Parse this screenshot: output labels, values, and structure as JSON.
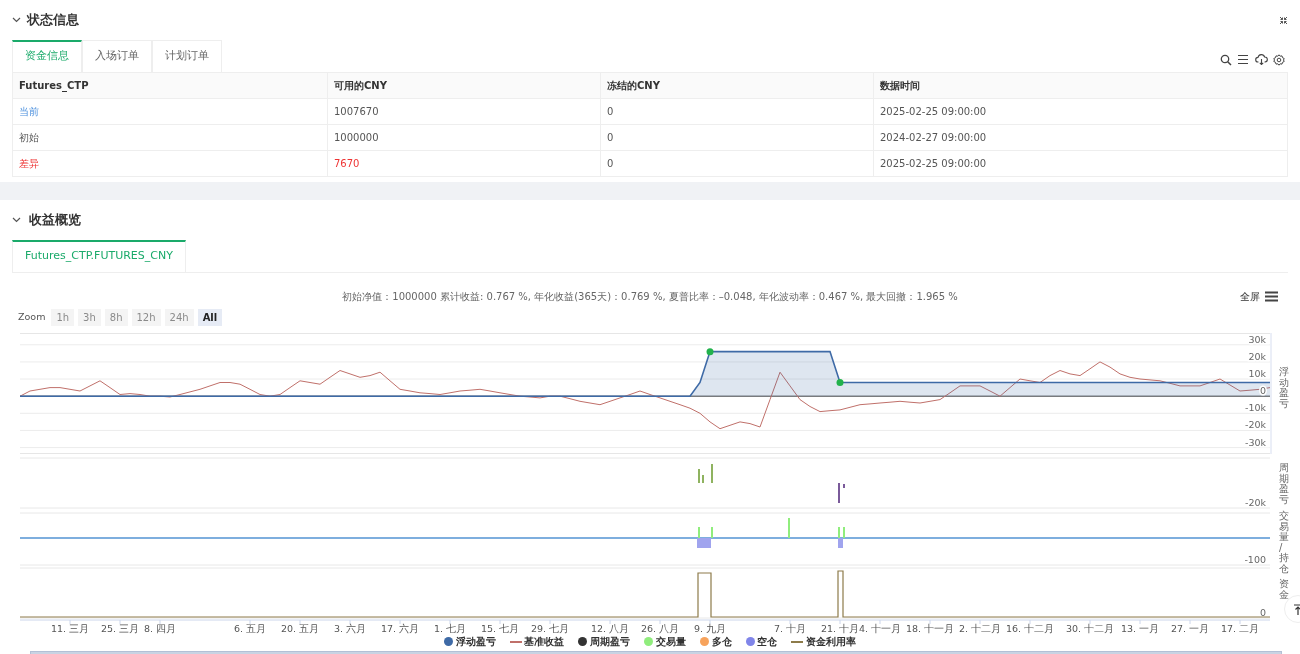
{
  "status_panel": {
    "title": "状态信息",
    "tabs": [
      {
        "label": "资金信息",
        "selected": true
      },
      {
        "label": "入场订单",
        "selected": false
      },
      {
        "label": "计划订单",
        "selected": false
      }
    ],
    "table": {
      "columns": [
        "Futures_CTP",
        "可用的CNY",
        "冻结的CNY",
        "数据时间"
      ],
      "rows": [
        {
          "kind": "current",
          "cells": [
            "当前",
            "1007670",
            "0",
            "2025-02-25 09:00:00"
          ]
        },
        {
          "kind": "initial",
          "cells": [
            "初始",
            "1000000",
            "0",
            "2024-02-27 09:00:00"
          ]
        },
        {
          "kind": "diff",
          "cells": [
            "差异",
            "7670",
            "0",
            "2025-02-25 09:00:00"
          ]
        }
      ]
    }
  },
  "returns_panel": {
    "title": "收益概览",
    "tabs": [
      {
        "label": "Futures_CTP.FUTURES_CNY",
        "selected": true
      }
    ],
    "summary": "初始净值：1000000 累计收益: 0.767 %, 年化收益(365天)：0.769 %, 夏普比率：–0.048, 年化波动率：0.467 %, 最大回撤：1.965 %",
    "fullscreen_label": "全屏",
    "zoom": {
      "label": "Zoom",
      "buttons": [
        {
          "label": "1h",
          "selected": false,
          "disabled": true
        },
        {
          "label": "3h",
          "selected": false,
          "disabled": true
        },
        {
          "label": "8h",
          "selected": false,
          "disabled": true
        },
        {
          "label": "12h",
          "selected": false,
          "disabled": true
        },
        {
          "label": "24h",
          "selected": false,
          "disabled": true
        },
        {
          "label": "All",
          "selected": true,
          "disabled": false
        }
      ]
    },
    "chart_data": {
      "type": "line",
      "ylabel": "浮动盈亏",
      "grid": true,
      "ylim": [
        -33750,
        36875
      ],
      "series": [
        {
          "name": "浮动盈亏",
          "color": "#3e6aa6",
          "values": [
            0,
            0,
            0,
            0,
            0,
            0,
            0,
            0,
            0,
            0,
            0,
            0,
            0,
            0,
            0,
            0,
            0,
            0,
            0,
            0,
            0,
            0,
            0,
            0,
            0,
            0,
            0,
            0,
            0,
            0,
            0,
            0,
            0,
            0,
            0,
            0,
            0,
            0,
            0,
            0,
            0,
            0,
            0,
            0,
            0,
            0,
            0,
            0,
            0,
            0,
            0,
            0,
            0,
            0,
            0,
            0,
            0,
            0,
            0,
            0,
            0,
            0,
            0,
            0,
            0,
            0,
            0,
            0,
            8000,
            26000,
            26000,
            26000,
            26000,
            26000,
            26000,
            26000,
            26000,
            26000,
            26000,
            26000,
            26000,
            26000,
            8000,
            8000,
            8000,
            8000,
            8000,
            8000,
            8000,
            8000,
            8000,
            8000,
            8000,
            8000,
            8000,
            8000,
            8000,
            8000,
            8000,
            8000,
            8000,
            8000,
            8000,
            8000,
            8000,
            8000,
            8000,
            8000,
            8000,
            8000,
            8000,
            8000,
            8000,
            8000,
            8000,
            8000,
            8000,
            8000,
            8000,
            8000,
            8000,
            8000,
            8000,
            8000,
            8000,
            8000
          ]
        },
        {
          "name": "基准收益",
          "color": "#c0706a",
          "values": [
            0,
            3000,
            4000,
            5000,
            5000,
            4000,
            3000,
            6000,
            9000,
            5000,
            1000,
            1500,
            1000,
            0,
            0,
            -500,
            1000,
            2500,
            4000,
            6000,
            8000,
            8000,
            7000,
            4000,
            1000,
            0,
            1000,
            5000,
            9000,
            8000,
            7000,
            11000,
            15000,
            13000,
            11000,
            12000,
            14000,
            9000,
            4000,
            3000,
            2000,
            1500,
            1000,
            2000,
            3000,
            3500,
            4000,
            3000,
            2000,
            1000,
            0,
            -500,
            -1000,
            0,
            0,
            -1500,
            -3000,
            -4000,
            -5000,
            -3000,
            -1000,
            1000,
            3000,
            1000,
            -1000,
            -3000,
            -5000,
            -7000,
            -10000,
            -15000,
            -19000,
            -17000,
            -15000,
            -16000,
            -18000,
            -2000,
            14000,
            6000,
            -2000,
            -6000,
            -9000,
            -8500,
            -8000,
            -6500,
            -5000,
            -4500,
            -4000,
            -3500,
            -3000,
            -3500,
            -4000,
            -3000,
            -2000,
            2000,
            6000,
            6000,
            6000,
            3000,
            0,
            5000,
            10000,
            9000,
            8000,
            12000,
            15000,
            13000,
            12000,
            16000,
            20000,
            17000,
            13000,
            11000,
            10000,
            9500,
            9000,
            7500,
            6000,
            6000,
            6000,
            8000,
            10000,
            6500,
            3000,
            3500,
            4000,
            5000
          ]
        }
      ],
      "yticks": [
        {
          "value": -30000,
          "label": "-30k"
        },
        {
          "value": -20000,
          "label": "-20k"
        },
        {
          "value": -10000,
          "label": "-10k"
        },
        {
          "value": 0,
          "label": "0"
        },
        {
          "value": 10000,
          "label": "10k"
        },
        {
          "value": 20000,
          "label": "20k"
        },
        {
          "value": 30000,
          "label": "30k"
        }
      ]
    },
    "sub_panels": [
      {
        "axis_title": "周期盈亏",
        "tick": "-20k"
      },
      {
        "axis_title": "交易量/持仓",
        "tick": "-100"
      },
      {
        "axis_title": "资金",
        "tick": "0"
      }
    ],
    "date_axis": [
      "11. 三月",
      "25. 三月",
      "8. 四月",
      "6. 五月",
      "20. 五月",
      "3. 六月",
      "17. 六月",
      "1. 七月",
      "15. 七月",
      "29. 七月",
      "12. 八月",
      "26. 八月",
      "9. 九月",
      "7. 十月",
      "21. 十月",
      "4. 十一月",
      "18. 十一月",
      "2. 十二月",
      "16. 十二月",
      "30. 十二月",
      "13. 一月",
      "27. 一月",
      "17. 二月"
    ],
    "legend": [
      {
        "label": "周期盈亏",
        "kind": "dot",
        "color": "#333333"
      },
      {
        "label": "交易量",
        "kind": "dot",
        "color": "#90ed7d"
      },
      {
        "label": "多仓",
        "kind": "dot",
        "color": "#f7a35c"
      },
      {
        "label": "空仓",
        "kind": "dot",
        "color": "#8085e9"
      },
      {
        "label": "资金利用率",
        "kind": "line",
        "color": "#8d7b4a"
      }
    ]
  }
}
